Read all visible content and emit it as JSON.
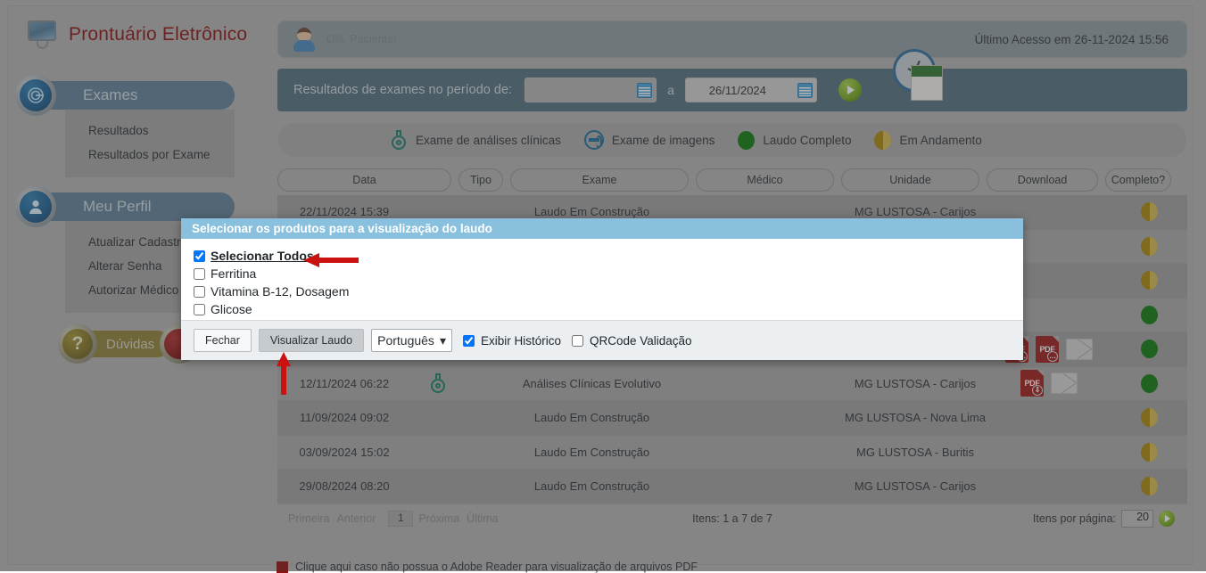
{
  "brand": {
    "title": "Prontuário Eletrônico",
    "logo_icon": "monitor-icon"
  },
  "sidebar": {
    "groups": [
      {
        "label": "Exames",
        "icon": "exam-badge-icon",
        "items": [
          {
            "label": "Resultados"
          },
          {
            "label": "Resultados por Exame"
          }
        ]
      },
      {
        "label": "Meu Perfil",
        "icon": "user-badge-icon",
        "items": [
          {
            "label": "Atualizar Cadastro"
          },
          {
            "label": "Alterar Senha"
          },
          {
            "label": "Autorizar Médico"
          }
        ]
      }
    ],
    "buttons": [
      {
        "label": "Dúvidas",
        "glyph": "?",
        "style": "gold"
      },
      {
        "label": "",
        "glyph": "",
        "style": "red"
      }
    ]
  },
  "header": {
    "greeting": "Olá, Paciente!",
    "last_access": "Último Acesso em 26-11-2024 15:56",
    "avatar_icon": "avatar"
  },
  "period": {
    "label": "Resultados de exames no período de:",
    "date_from": "",
    "date_from_placeholder": "",
    "separator": "a",
    "date_to": "26/11/2024",
    "go_icon": "play-icon",
    "calendar_icon": "calendar-icon",
    "clock_icon": "clock-calendar-icon"
  },
  "legend": [
    {
      "label": "Exame de análises clínicas",
      "icon": "flask-icon"
    },
    {
      "label": "Exame de imagens",
      "icon": "imaging-icon"
    },
    {
      "label": "Laudo Completo",
      "icon": "status-complete-icon"
    },
    {
      "label": "Em Andamento",
      "icon": "status-inprogress-icon"
    }
  ],
  "table": {
    "columns": [
      {
        "label": "Data",
        "key": "data"
      },
      {
        "label": "Tipo",
        "key": "tipo"
      },
      {
        "label": "Exame",
        "key": "exame"
      },
      {
        "label": "Médico",
        "key": "medico"
      },
      {
        "label": "Unidade",
        "key": "unidade"
      },
      {
        "label": "Download",
        "key": "download"
      },
      {
        "label": "Completo?",
        "key": "completo"
      }
    ],
    "rows": [
      {
        "data": "22/11/2024 15:39",
        "tipo": "",
        "exame": "Laudo Em Construção",
        "medico": "",
        "unidade": "MG LUSTOSA - Carijos",
        "download": [],
        "completo": "inprogress"
      },
      {
        "data": "",
        "tipo": "",
        "exame": "",
        "medico": "",
        "unidade": "",
        "download": [],
        "completo": "inprogress"
      },
      {
        "data": "",
        "tipo": "",
        "exame": "",
        "medico": "",
        "unidade": "",
        "download": [],
        "completo": "inprogress"
      },
      {
        "data": "",
        "tipo": "",
        "exame": "",
        "medico": "",
        "unidade": "",
        "download": [],
        "completo": "complete"
      },
      {
        "data": "",
        "tipo": "",
        "exame": "",
        "medico": "",
        "unidade": "",
        "download": [
          "pdf",
          "pdf",
          "mail"
        ],
        "completo": "complete"
      },
      {
        "data": "12/11/2024 06:22",
        "tipo": "flask",
        "exame": "Análises Clínicas Evolutivo",
        "medico": "",
        "unidade": "MG LUSTOSA - Carijos",
        "download": [
          "pdf",
          "mail"
        ],
        "completo": "complete"
      },
      {
        "data": "11/09/2024 09:02",
        "tipo": "",
        "exame": "Laudo Em Construção",
        "medico": "",
        "unidade": "MG LUSTOSA - Nova Lima",
        "download": [],
        "completo": "inprogress"
      },
      {
        "data": "03/09/2024 15:02",
        "tipo": "",
        "exame": "Laudo Em Construção",
        "medico": "",
        "unidade": "MG LUSTOSA - Buritis",
        "download": [],
        "completo": "inprogress"
      },
      {
        "data": "29/08/2024 08:20",
        "tipo": "",
        "exame": "Laudo Em Construção",
        "medico": "",
        "unidade": "MG LUSTOSA - Carijos",
        "download": [],
        "completo": "inprogress"
      }
    ]
  },
  "pager": {
    "first": "Primeira",
    "prev": "Anterior",
    "page": "1",
    "next": "Próxima",
    "last": "Última",
    "items_info": "Itens: 1 a 7 de 7",
    "per_page_label": "Itens por página:",
    "per_page_value": "20",
    "go_icon": "play-icon"
  },
  "footer": {
    "adobe_note": "Clique aqui caso não possua o Adobe Reader para visualização de arquivos PDF"
  },
  "modal": {
    "title": "Selecionar os produtos para a visualização do laudo",
    "options": [
      {
        "label": "Selecionar Todos",
        "checked": true,
        "is_link": true
      },
      {
        "label": "Ferritina",
        "checked": false,
        "is_link": false
      },
      {
        "label": "Vitamina B-12, Dosagem",
        "checked": false,
        "is_link": false
      },
      {
        "label": "Glicose",
        "checked": false,
        "is_link": false
      }
    ],
    "close_label": "Fechar",
    "view_label": "Visualizar Laudo",
    "language": "Português",
    "language_options": [
      "Português"
    ],
    "show_history_label": "Exibir Histórico",
    "show_history_checked": true,
    "qrcode_label": "QRCode Validação",
    "qrcode_checked": false
  },
  "colors": {
    "accent": "#88c0dd",
    "brand": "#8b1212",
    "sidebar": "#5f8098",
    "period_bar": "#53707f",
    "status_complete": "#107a10",
    "status_inprogress": "#a8860b",
    "arrow": "#cc1111"
  }
}
